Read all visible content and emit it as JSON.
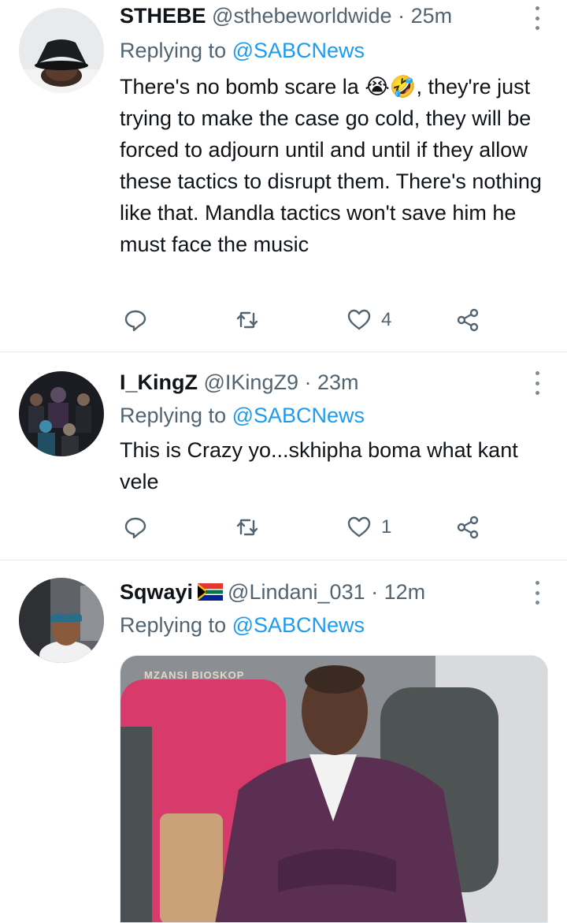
{
  "tweets": [
    {
      "name": "STHEBE",
      "handle": "@sthebeworldwide",
      "separator": "·",
      "time": "25m",
      "replying_prefix": "Replying to",
      "replying_mention": "@SABCNews",
      "text": "There's no bomb scare la 😭🤣, they're just trying to make the case go cold, they will be forced to adjourn until and until if they allow these tactics to disrupt them. There's nothing like that. Mandla tactics won't save him he must face the music",
      "like_count": "4",
      "avatar_icon": "avatar-bucket-hat"
    },
    {
      "name": "I_KingZ",
      "handle": "@IKingZ9",
      "separator": "·",
      "time": "23m",
      "replying_prefix": "Replying to",
      "replying_mention": "@SABCNews",
      "text": "This is Crazy yo...skhipha boma what kant vele",
      "like_count": "1",
      "avatar_icon": "avatar-group-photo"
    },
    {
      "name": "Sqwayi",
      "flag": "🇿🇦",
      "handle": "@Lindani_031",
      "separator": "·",
      "time": "12m",
      "replying_prefix": "Replying to",
      "replying_mention": "@SABCNews",
      "media_watermark": "MZANSI BIOSKOP",
      "avatar_icon": "avatar-beanie-car"
    }
  ],
  "colors": {
    "text": "#0f1419",
    "secondary": "#536471",
    "link": "#1d9bf0",
    "divider": "#e6ecf0"
  },
  "icons": [
    "reply-icon",
    "retweet-icon",
    "like-icon",
    "share-icon",
    "more-icon"
  ]
}
